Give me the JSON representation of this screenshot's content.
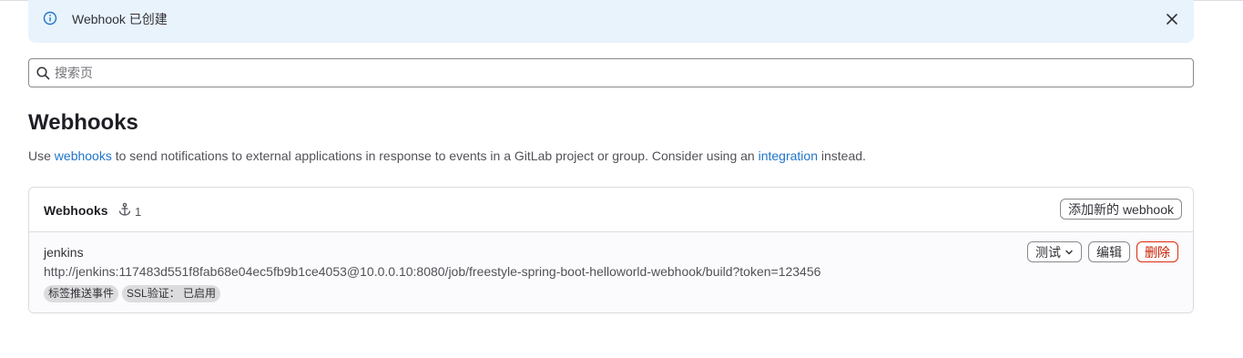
{
  "alert": {
    "message": "Webhook 已创建"
  },
  "search": {
    "placeholder": "搜索页"
  },
  "page": {
    "title": "Webhooks",
    "description_before": "Use ",
    "description_link1": "webhooks",
    "description_middle": " to send notifications to external applications in response to events in a GitLab project or group. Consider using an ",
    "description_link2": "integration",
    "description_after": " instead."
  },
  "card": {
    "header_title": "Webhooks",
    "count": "1",
    "add_button_label": "添加新的 webhook",
    "hooks": [
      {
        "name": "jenkins",
        "url": "http://jenkins:117483d551f8fab68e04ec5fb9b1ce4053@10.0.0.10:8080/job/freestyle-spring-boot-helloworld-webhook/build?token=123456",
        "badges": [
          "标签推送事件",
          "SSL验证： 已启用"
        ],
        "test_label": "测试",
        "edit_label": "编辑",
        "delete_label": "删除"
      }
    ]
  },
  "colors": {
    "accent_link": "#1f75cb",
    "alert_bg": "#e9f3fc",
    "danger": "#dd2b0e"
  },
  "icons": [
    "info-icon",
    "close-icon",
    "search-icon",
    "webhook-icon",
    "chevron-down-icon"
  ]
}
